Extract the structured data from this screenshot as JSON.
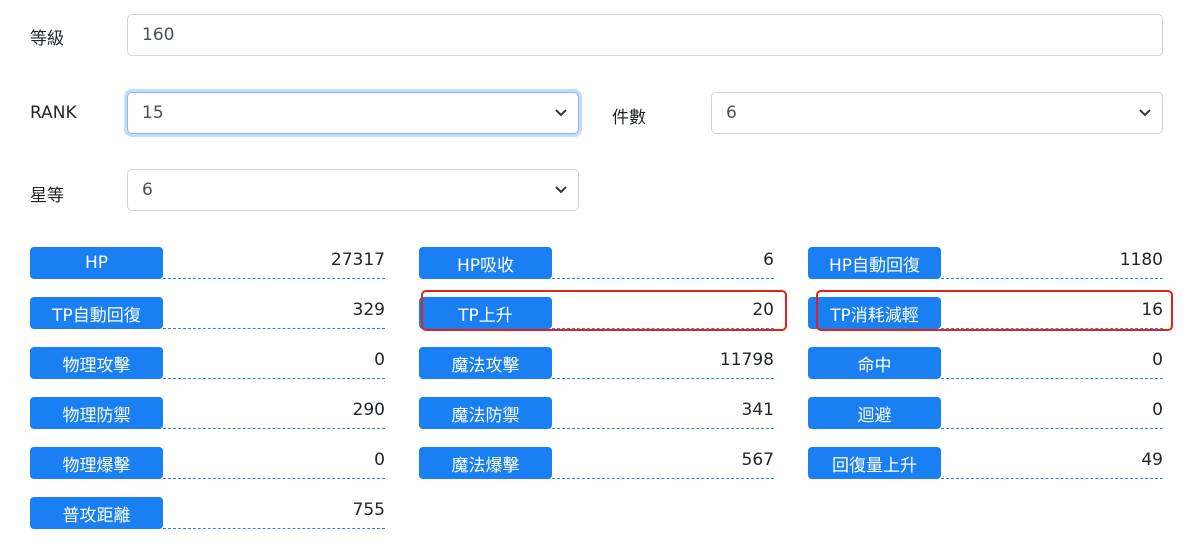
{
  "form": {
    "level": {
      "label": "等級",
      "value": "160"
    },
    "rank": {
      "label": "RANK",
      "value": "15"
    },
    "count": {
      "label": "件數",
      "value": "6"
    },
    "star": {
      "label": "星等",
      "value": "6"
    }
  },
  "stats": {
    "col1": [
      {
        "label": "HP",
        "value": "27317"
      },
      {
        "label": "TP自動回復",
        "value": "329"
      },
      {
        "label": "物理攻擊",
        "value": "0"
      },
      {
        "label": "物理防禦",
        "value": "290"
      },
      {
        "label": "物理爆擊",
        "value": "0"
      },
      {
        "label": "普攻距離",
        "value": "755"
      }
    ],
    "col2": [
      {
        "label": "HP吸收",
        "value": "6"
      },
      {
        "label": "TP上升",
        "value": "20"
      },
      {
        "label": "魔法攻擊",
        "value": "11798"
      },
      {
        "label": "魔法防禦",
        "value": "341"
      },
      {
        "label": "魔法爆擊",
        "value": "567"
      }
    ],
    "col3": [
      {
        "label": "HP自動回復",
        "value": "1180"
      },
      {
        "label": "TP消耗減輕",
        "value": "16"
      },
      {
        "label": "命中",
        "value": "0"
      },
      {
        "label": "迴避",
        "value": "0"
      },
      {
        "label": "回復量上升",
        "value": "49"
      }
    ]
  },
  "colors": {
    "badge": "#1a7ff2",
    "highlight": "#e0231a",
    "focus": "#86b7fe"
  }
}
